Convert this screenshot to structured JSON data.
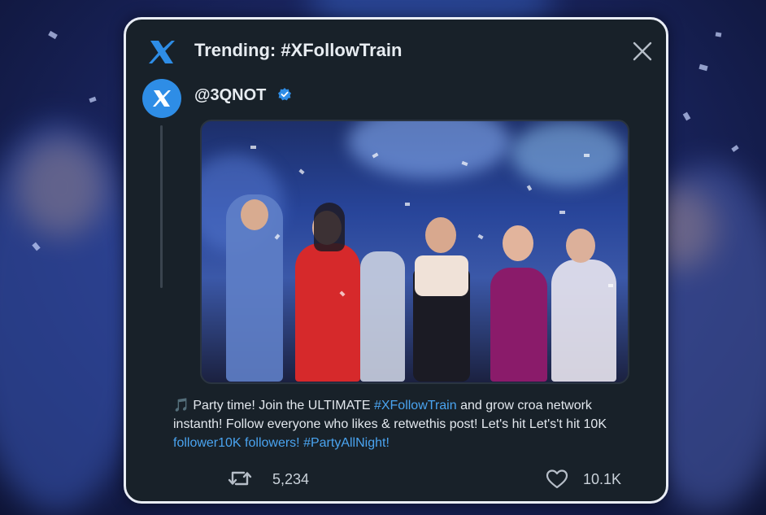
{
  "header": {
    "title": "Trending: #XFollowTrain"
  },
  "post": {
    "handle": "@3QNOT",
    "text": {
      "emoji": "🎵",
      "part1": " Party time! Join the ULTIMATE ",
      "hashtag1": "#XFollowTrain",
      "part2": " and grow croa network instanth! Follow everyone who likes & retwethis post! Let's hit Let's't hit 10K ",
      "hashtag2": "follower10K followers! #PartyAllNight!"
    },
    "image_description_icon": "party-photo"
  },
  "actions": {
    "retweet_count": "5,234",
    "like_count": "10.1K"
  },
  "colors": {
    "brand": "#2e8de6",
    "hashtag": "#4aa4f0",
    "card_bg": "#182129"
  },
  "icons": [
    "x-logo-icon",
    "close-icon",
    "verified-badge-icon",
    "retweet-icon",
    "heart-icon",
    "music-note-icon"
  ]
}
